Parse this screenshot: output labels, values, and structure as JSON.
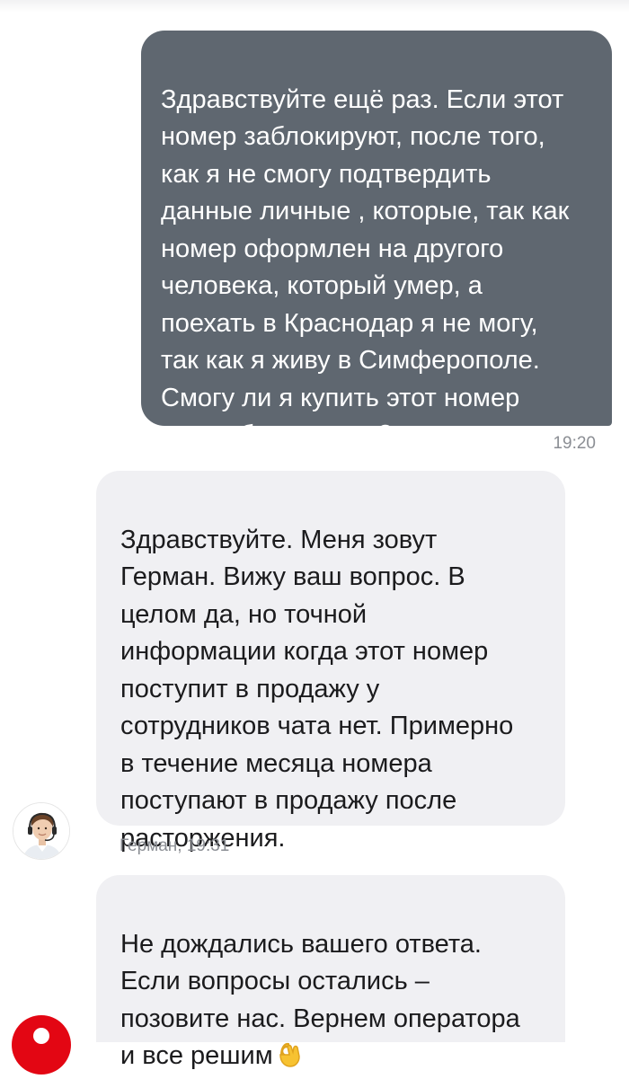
{
  "messages": {
    "outgoing": {
      "text": "Здравствуйте ещё раз. Если этот\nномер заблокируют, после того,\nкак я не смогу подтвердить\nданные личные , которые, так как\nномер оформлен на другого\nчеловека, который умер, а\nпоехать в Краснодар я не могу,\nтак как я живу в Симферополе.\nСмогу ли я купить этот номер\nпосле блокировки?",
      "time": "19:20"
    },
    "agent_reply": {
      "text": "Здравствуйте. Меня зовут\nГерман. Вижу ваш вопрос. В\nцелом да, но точной\nинформации когда этот номер\nпоступит в продажу у\nсотрудников чата нет. Примерно\nв течение месяца номера\nпоступают в продажу после\nрасторжения.",
      "meta": "Герман, 19:31"
    },
    "bot_followup": {
      "text": "Не дождались вашего ответа.\nЕсли вопросы остались –\nпозовите нас. Вернем оператора\nи все решим",
      "emoji": "ok-hand-icon"
    }
  },
  "colors": {
    "outgoing_bubble": "#5f6770",
    "incoming_bubble": "#f0f0f3",
    "brand": "#e30613",
    "meta_text": "#8b8e94"
  }
}
